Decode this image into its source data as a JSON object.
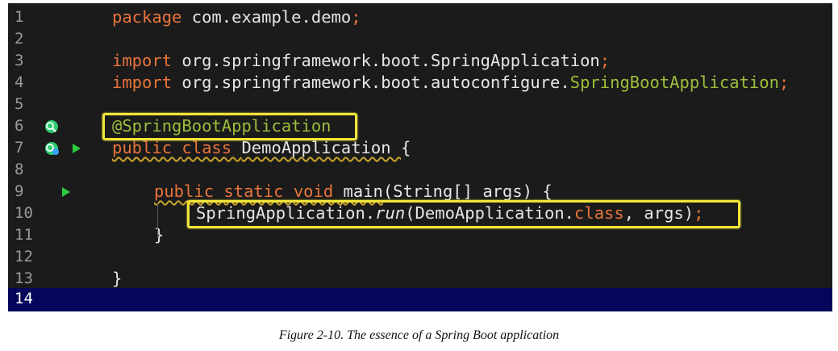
{
  "editor": {
    "lines": [
      {
        "number": "1",
        "tokens": [
          {
            "text": "package ",
            "cls": "kw"
          },
          {
            "text": "com.example.demo",
            "cls": "plain"
          },
          {
            "text": ";",
            "cls": "kw"
          }
        ]
      },
      {
        "number": "2",
        "tokens": []
      },
      {
        "number": "3",
        "tokens": [
          {
            "text": "import ",
            "cls": "kw"
          },
          {
            "text": "org.springframework.boot.SpringApplication",
            "cls": "plain"
          },
          {
            "text": ";",
            "cls": "kw"
          }
        ]
      },
      {
        "number": "4",
        "tokens": [
          {
            "text": "import ",
            "cls": "kw"
          },
          {
            "text": "org.springframework.boot.autoconfigure.",
            "cls": "plain"
          },
          {
            "text": "SpringBootApplication",
            "cls": "ann"
          },
          {
            "text": ";",
            "cls": "kw"
          }
        ]
      },
      {
        "number": "5",
        "tokens": []
      },
      {
        "number": "6",
        "tokens": [
          {
            "text": "@SpringBootApplication",
            "cls": "ann"
          }
        ]
      },
      {
        "number": "7",
        "tokens": [
          {
            "text": "public ",
            "cls": "kw squig"
          },
          {
            "text": "class ",
            "cls": "kw squig"
          },
          {
            "text": "DemoApplication ",
            "cls": "plain squig"
          },
          {
            "text": "{",
            "cls": "plain"
          }
        ]
      },
      {
        "number": "8",
        "tokens": []
      },
      {
        "number": "9",
        "tokens": [
          {
            "text": "public ",
            "cls": "kw squig"
          },
          {
            "text": "static ",
            "cls": "kw squig"
          },
          {
            "text": "void ",
            "cls": "kw squig"
          },
          {
            "text": "main",
            "cls": "plain squig"
          },
          {
            "text": "(String[] args) {",
            "cls": "plain"
          }
        ]
      },
      {
        "number": "10",
        "tokens": [
          {
            "text": "SpringApplication.",
            "cls": "plain"
          },
          {
            "text": "run",
            "cls": "plain italic"
          },
          {
            "text": "(DemoApplication.",
            "cls": "plain"
          },
          {
            "text": "class",
            "cls": "kw"
          },
          {
            "text": ", args)",
            "cls": "plain"
          },
          {
            "text": ";",
            "cls": "kw"
          }
        ]
      },
      {
        "number": "11",
        "tokens": [
          {
            "text": "}",
            "cls": "plain"
          }
        ]
      },
      {
        "number": "12",
        "tokens": []
      },
      {
        "number": "13",
        "tokens": [
          {
            "text": "}",
            "cls": "plain"
          }
        ]
      },
      {
        "number": "14",
        "tokens": []
      }
    ],
    "current_line": "14",
    "gutter_icons": [
      "bean-search-icon",
      "bean-run-icon",
      "run-arrow-icon"
    ]
  },
  "caption": {
    "text": "Figure 2-10. The essence of a Spring Boot application"
  },
  "colors": {
    "editor_bg": "#1b1b1b",
    "keyword": "#e8743b",
    "annotation": "#9bbf3a",
    "highlight_box": "#f1e53b",
    "current_line_bg": "#04065a",
    "run_arrow": "#2ecc40"
  }
}
